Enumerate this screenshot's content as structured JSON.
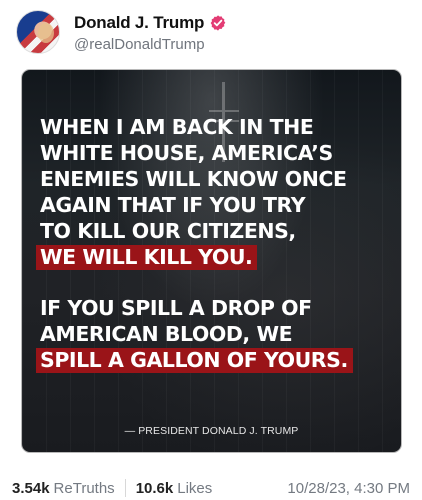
{
  "post": {
    "author": {
      "display_name": "Donald J. Trump",
      "handle": "@realDonaldTrump",
      "verified": true,
      "avatar_icon": "portrait-flag-avatar"
    },
    "media": {
      "quote_lines": [
        "WHEN I AM BACK IN THE",
        "WHITE HOUSE, AMERICA’S",
        "ENEMIES WILL KNOW ONCE",
        "AGAIN THAT IF YOU TRY",
        "TO KILL OUR CITIZENS,",
        "WE WILL KILL YOU.",
        "IF YOU SPILL A DROP OF",
        "AMERICAN BLOOD, WE",
        "SPILL A GALLON OF YOURS."
      ],
      "attribution": "— PRESIDENT DONALD J. TRUMP",
      "highlight_color": "#9A1418"
    },
    "stats": {
      "retruths_count": "3.54k",
      "retruths_label": "ReTruths",
      "likes_count": "10.6k",
      "likes_label": "Likes",
      "timestamp": "10/28/23, 4:30 PM"
    }
  },
  "colors": {
    "verified_badge": "#E33C74",
    "secondary_text": "#747A82",
    "primary_text": "#111111"
  }
}
